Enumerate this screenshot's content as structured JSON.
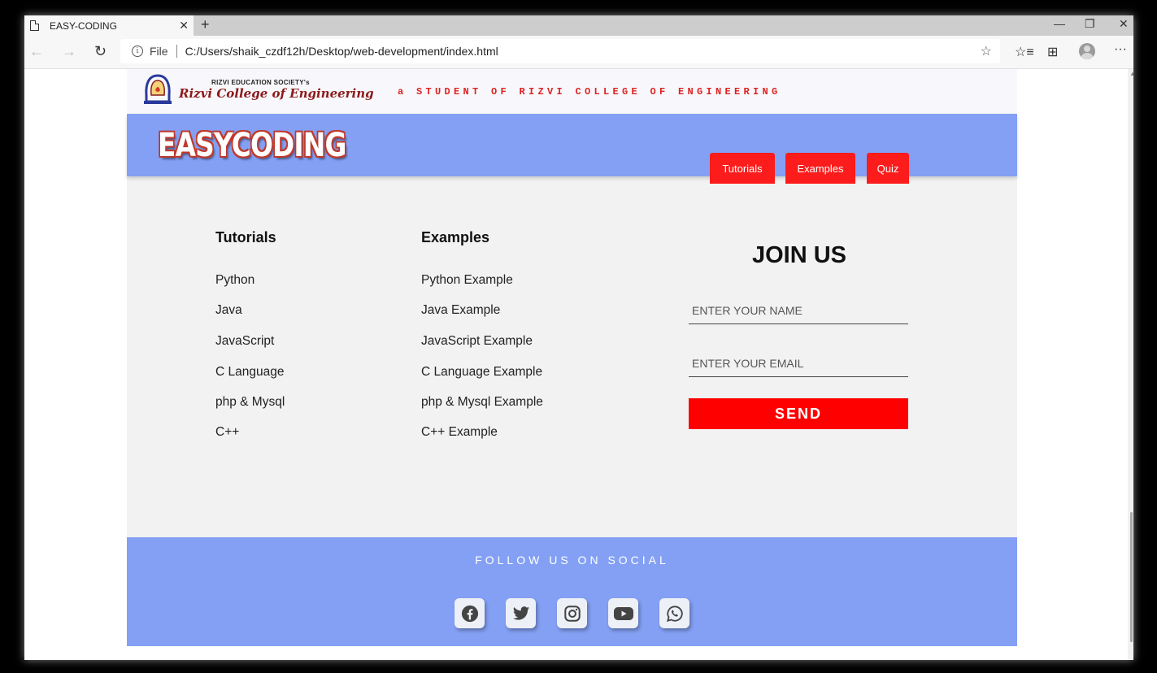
{
  "browser": {
    "tab_title": "EASY-CODING",
    "tab_close": "✕",
    "new_tab": "+",
    "minimize": "—",
    "maximize": "❐",
    "close": "✕",
    "back": "←",
    "forward": "→",
    "reload": "↻",
    "info": "i",
    "file_label": "File",
    "url": "C:/Users/shaik_czdf12h/Desktop/web-development/index.html",
    "favorite": "☆",
    "favorites_bar": "☆≡",
    "collections": "⊞",
    "more": "···"
  },
  "header": {
    "society": "RIZVI EDUCATION SOCIETY's",
    "college": "Rizvi College of Engineering",
    "tagline": "a STUDENT OF RIZVI COLLEGE OF ENGINEERING"
  },
  "hero": {
    "brand": "EASYCODING",
    "nav": [
      "Tutorials",
      "Examples",
      "Quiz"
    ]
  },
  "tutorials": {
    "title": "Tutorials",
    "items": [
      "Python",
      "Java",
      "JavaScript",
      "C Language",
      "php & Mysql",
      "C++"
    ]
  },
  "examples": {
    "title": "Examples",
    "items": [
      "Python Example",
      "Java Example",
      "JavaScript Example",
      "C Language Example",
      "php & Mysql Example",
      "C++ Example"
    ]
  },
  "join": {
    "title": "JOIN US",
    "name_placeholder": "ENTER YOUR NAME",
    "email_placeholder": "ENTER YOUR EMAIL",
    "send_label": "SEND"
  },
  "footer": {
    "follow": "FOLLOW US ON SOCIAL",
    "icons": [
      "facebook-icon",
      "twitter-icon",
      "instagram-icon",
      "youtube-icon",
      "whatsapp-icon"
    ]
  },
  "colors": {
    "hero_bg": "#84a0f4",
    "accent_red": "#fc1c1c",
    "page_bg": "#f2f2f2"
  }
}
